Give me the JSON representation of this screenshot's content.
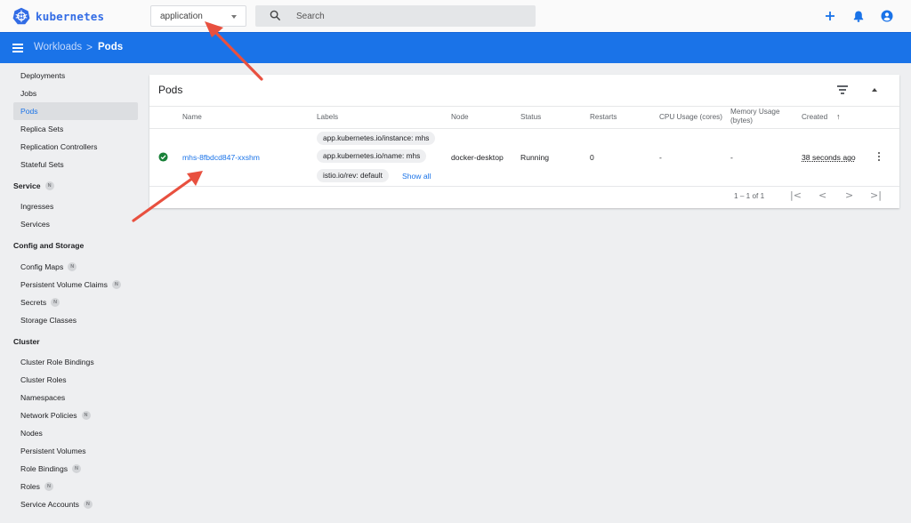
{
  "app": {
    "brand": "kubernetes",
    "brand_color": "#326ce5",
    "accent_color": "#1a73e8"
  },
  "topbar": {
    "namespace_value": "application",
    "search_placeholder": "Search",
    "icons": [
      "add-icon",
      "notifications-icon",
      "account-icon"
    ]
  },
  "breadcrumb": {
    "parent": "Workloads",
    "separator": ">",
    "current": "Pods"
  },
  "sidebar": {
    "items": [
      {
        "label": "Deployments"
      },
      {
        "label": "Jobs"
      },
      {
        "label": "Pods",
        "active": true
      },
      {
        "label": "Replica Sets"
      },
      {
        "label": "Replication Controllers"
      },
      {
        "label": "Stateful Sets"
      }
    ],
    "groups": [
      {
        "label": "Service",
        "badge": "N",
        "items": [
          {
            "label": "Ingresses"
          },
          {
            "label": "Services"
          }
        ]
      },
      {
        "label": "Config and Storage",
        "items": [
          {
            "label": "Config Maps",
            "badge": "N"
          },
          {
            "label": "Persistent Volume Claims",
            "badge": "N"
          },
          {
            "label": "Secrets",
            "badge": "N"
          },
          {
            "label": "Storage Classes"
          }
        ]
      },
      {
        "label": "Cluster",
        "items": [
          {
            "label": "Cluster Role Bindings"
          },
          {
            "label": "Cluster Roles"
          },
          {
            "label": "Namespaces"
          },
          {
            "label": "Network Policies",
            "badge": "N"
          },
          {
            "label": "Nodes"
          },
          {
            "label": "Persistent Volumes"
          },
          {
            "label": "Role Bindings",
            "badge": "N"
          },
          {
            "label": "Roles",
            "badge": "N"
          },
          {
            "label": "Service Accounts",
            "badge": "N"
          }
        ]
      }
    ]
  },
  "pods_card": {
    "title": "Pods",
    "columns": [
      "Name",
      "Labels",
      "Node",
      "Status",
      "Restarts",
      "CPU Usage (cores)",
      "Memory Usage (bytes)",
      "Created"
    ],
    "sort_indicator": "↑",
    "rows": [
      {
        "status_icon": "check-circle-icon",
        "status_color": "#188038",
        "name": "mhs-8fbdcd847-xxshm",
        "labels": [
          "app.kubernetes.io/instance: mhs",
          "app.kubernetes.io/name: mhs",
          "istio.io/rev: default"
        ],
        "show_all": "Show all",
        "node": "docker-desktop",
        "status": "Running",
        "restarts": "0",
        "cpu": "-",
        "memory": "-",
        "created": "38 seconds ago"
      }
    ],
    "pagination": {
      "range": "1 – 1 of 1",
      "first": "|<",
      "prev": "<",
      "next": ">",
      "last": ">|"
    }
  },
  "annotation_color": "#e8503f"
}
